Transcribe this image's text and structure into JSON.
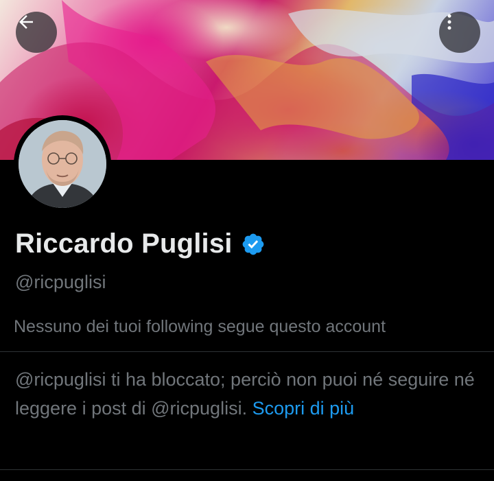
{
  "header": {
    "back_icon": "arrow-left-icon",
    "more_icon": "vertical-dots-icon"
  },
  "profile": {
    "name": "Riccardo Puglisi",
    "verified": true,
    "verified_color": "#1d9bf0",
    "handle": "@ricpuglisi",
    "following_note": "Nessuno dei tuoi following segue questo account"
  },
  "blocked_notice": {
    "text": "@ricpuglisi ti ha bloccato; perciò non puoi né seguire né leggere i post di @ricpuglisi.",
    "link_label": "Scopri di più",
    "link_color": "#1d9bf0"
  },
  "colors": {
    "background": "#000000",
    "secondary_text": "#71767b",
    "primary_text": "#e7e9ea"
  }
}
